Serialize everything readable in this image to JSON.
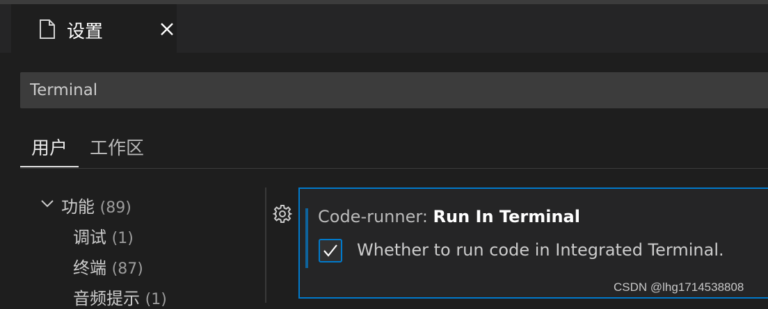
{
  "tab": {
    "title": "设置",
    "file_icon": "file-icon",
    "close_icon": "close-icon"
  },
  "search": {
    "value": "Terminal"
  },
  "scopes": [
    {
      "label": "用户",
      "active": true
    },
    {
      "label": "工作区",
      "active": false
    }
  ],
  "toc": {
    "group": {
      "label": "功能",
      "count": "(89)",
      "expanded": true
    },
    "items": [
      {
        "label": "调试",
        "count": "(1)"
      },
      {
        "label": "终端",
        "count": "(87)"
      },
      {
        "label": "音频提示",
        "count": "(1)"
      }
    ]
  },
  "setting": {
    "category": "Code-runner: ",
    "key": "Run In Terminal",
    "description": "Whether to run code in Integrated Terminal.",
    "checked": true,
    "gear_icon": "gear-icon"
  },
  "watermark": "CSDN @lhg1714538808",
  "colors": {
    "accent": "#007acc",
    "background": "#1e1e1e",
    "tab_strip": "#252526",
    "input": "#3c3c3c"
  }
}
